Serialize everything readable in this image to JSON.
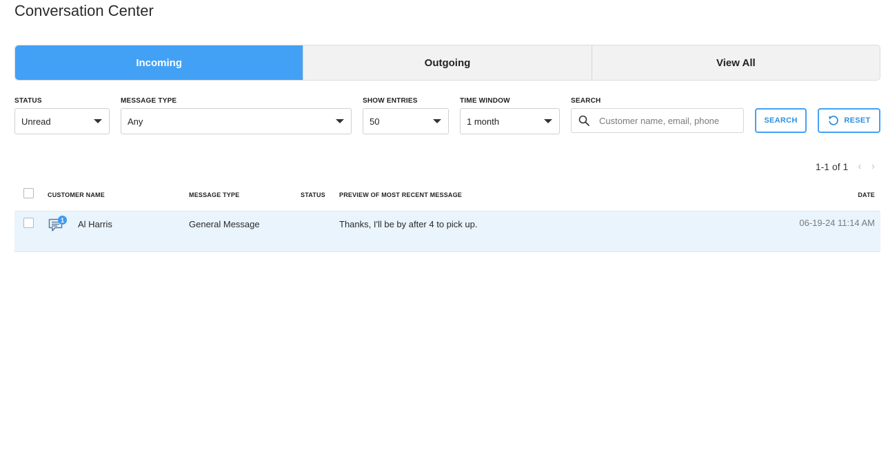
{
  "page": {
    "title": "Conversation Center"
  },
  "tabs": [
    {
      "label": "Incoming",
      "active": true
    },
    {
      "label": "Outgoing",
      "active": false
    },
    {
      "label": "View All",
      "active": false
    }
  ],
  "filters": {
    "status": {
      "label": "STATUS",
      "value": "Unread"
    },
    "message_type": {
      "label": "MESSAGE TYPE",
      "value": "Any"
    },
    "show_entries": {
      "label": "SHOW ENTRIES",
      "value": "50"
    },
    "time_window": {
      "label": "TIME WINDOW",
      "value": "1 month"
    },
    "search": {
      "label": "SEARCH",
      "placeholder": "Customer name, email, phone",
      "value": ""
    }
  },
  "buttons": {
    "search": "SEARCH",
    "reset": "RESET"
  },
  "pagination": {
    "range": "1-1 of 1"
  },
  "table": {
    "headers": {
      "customer_name": "CUSTOMER NAME",
      "message_type": "MESSAGE TYPE",
      "status": "STATUS",
      "preview": "PREVIEW OF MOST RECENT MESSAGE",
      "date": "DATE"
    },
    "rows": [
      {
        "unread_count": "1",
        "customer_name": "Al Harris",
        "message_type": "General Message",
        "status": "",
        "preview": "Thanks, I'll be by after 4 to pick up.",
        "date": "06-19-24 11:14 AM"
      }
    ]
  },
  "colors": {
    "accent": "#42a1f5",
    "row_highlight": "#e9f4fd",
    "tab_inactive": "#f2f2f2"
  }
}
